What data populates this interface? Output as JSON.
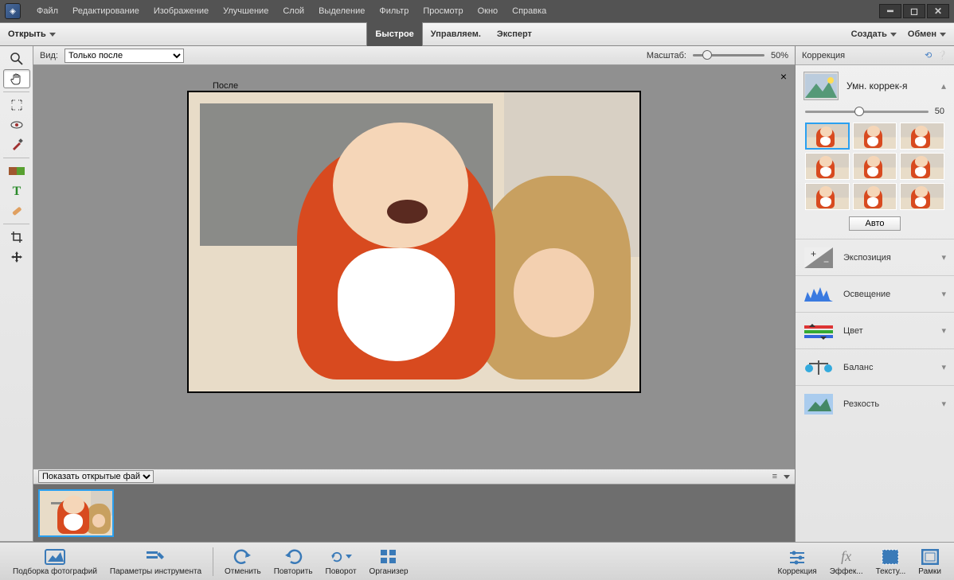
{
  "menubar": {
    "items": [
      "Файл",
      "Редактирование",
      "Изображение",
      "Улучшение",
      "Слой",
      "Выделение",
      "Фильтр",
      "Просмотр",
      "Окно",
      "Справка"
    ]
  },
  "actionbar": {
    "open": "Открыть",
    "modes": {
      "quick": "Быстрое",
      "managed": "Управляем.",
      "expert": "Эксперт"
    },
    "create": "Создать",
    "share": "Обмен"
  },
  "viewbar": {
    "view_label": "Вид:",
    "view_option": "Только после",
    "zoom_label": "Масштаб:",
    "zoom_value": "50%"
  },
  "canvas": {
    "label": "После"
  },
  "filmstrip": {
    "dropdown": "Показать открытые файлы"
  },
  "bottombar": {
    "photobin": "Подборка фотографий",
    "toolopts": "Параметры инструмента",
    "undo": "Отменить",
    "redo": "Повторить",
    "rotate": "Поворот",
    "organizer": "Организер",
    "r_correction": "Коррекция",
    "r_effects": "Эффек...",
    "r_textures": "Тексту...",
    "r_frames": "Рамки"
  },
  "rightpanel": {
    "header": "Коррекция",
    "smart_label": "Умн. коррек-я",
    "smart_value": "50",
    "auto": "Авто",
    "rows": {
      "exposure": "Экспозиция",
      "lighting": "Освещение",
      "color": "Цвет",
      "balance": "Баланс",
      "sharpness": "Резкость"
    }
  }
}
